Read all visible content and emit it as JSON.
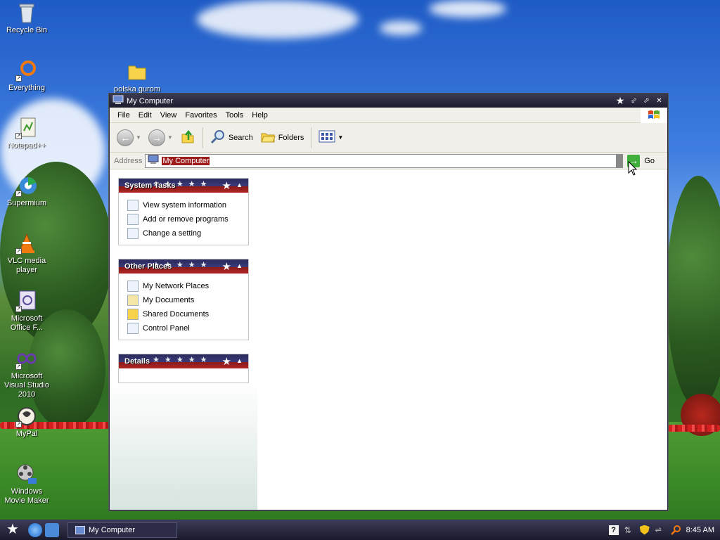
{
  "desktop": {
    "icons": [
      {
        "label": "Recycle Bin"
      },
      {
        "label": "Everything"
      },
      {
        "label": "Notepad++"
      },
      {
        "label": "Supermium"
      },
      {
        "label": "VLC media player"
      },
      {
        "label": "Microsoft Office F..."
      },
      {
        "label": "Microsoft Visual Studio 2010"
      },
      {
        "label": "MyPal"
      },
      {
        "label": "Windows Movie Maker"
      },
      {
        "label": "polska gurom"
      }
    ]
  },
  "window": {
    "title": "My Computer",
    "menu": [
      "File",
      "Edit",
      "View",
      "Favorites",
      "Tools",
      "Help"
    ],
    "toolbar": {
      "search_label": "Search",
      "folders_label": "Folders"
    },
    "address": {
      "label": "Address",
      "value": "My Computer",
      "go_label": "Go"
    },
    "panels": {
      "system_tasks": {
        "title": "System Tasks",
        "items": [
          "View system information",
          "Add or remove programs",
          "Change a setting"
        ]
      },
      "other_places": {
        "title": "Other Places",
        "items": [
          "My Network Places",
          "My Documents",
          "Shared Documents",
          "Control Panel"
        ]
      },
      "details": {
        "title": "Details"
      }
    }
  },
  "taskbar": {
    "task_label": "My Computer",
    "clock": "8:45 AM"
  },
  "colors": {
    "accent_red": "#9c1c1c",
    "title_navy": "#1c1c2e"
  }
}
